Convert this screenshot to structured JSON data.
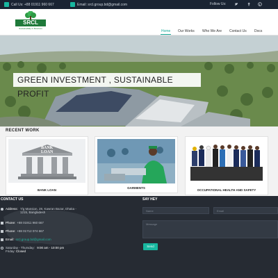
{
  "topbar": {
    "phone": "Call Us: +88 01911 960 667",
    "email": "Email: srcl.group.bd@gmail.com",
    "follow": "Follow Us:",
    "social": [
      "twitter-icon",
      "facebook-icon",
      "pinterest-icon"
    ]
  },
  "logo": {
    "brand": "SRCL",
    "tagline": "Sustainability in Business"
  },
  "nav": [
    "Home",
    "Our Works",
    "Who We Are",
    "Contact Us",
    "Docs"
  ],
  "hero": {
    "banner": "GREEN INVESTMENT , SUSTAINABLE PROFIT"
  },
  "recent_work": {
    "title": "RECENT WORK",
    "items": [
      {
        "caption": "BANK LOAN",
        "image_text": [
          "BANK",
          "LOAN"
        ]
      },
      {
        "caption": "GARMENTS"
      },
      {
        "caption": "OCCUPATIONAL HEALTH AND SAFETY"
      }
    ]
  },
  "footer": {
    "contact_title": "CONTACT US",
    "address_label": "Address:",
    "address": "7/g Mansion, 28, Kawran Bazar, Dhaka - 1215, Bangladesh",
    "phone1_label": "Phone:",
    "phone1": "+88 01911 960 667",
    "phone2_label": "Phone:",
    "phone2": "+88 01712 074 667",
    "email_label": "Email:",
    "email": "srcl.group.bd@gmail.com",
    "hours_days": "Saturday - Thursday:",
    "hours_time": "9:00 am - 10:00 pm",
    "friday": "Friday:",
    "friday_status": "Closed",
    "say_hey_title": "SAY HEY",
    "name_placeholder": "Name",
    "email_placeholder": "Email",
    "message_placeholder": "Message",
    "send_label": "Send"
  },
  "colors": {
    "accent": "#18b7a0",
    "dark": "#1a2433",
    "footer_bg": "#262b33",
    "brand_green": "#1f7a3a"
  }
}
